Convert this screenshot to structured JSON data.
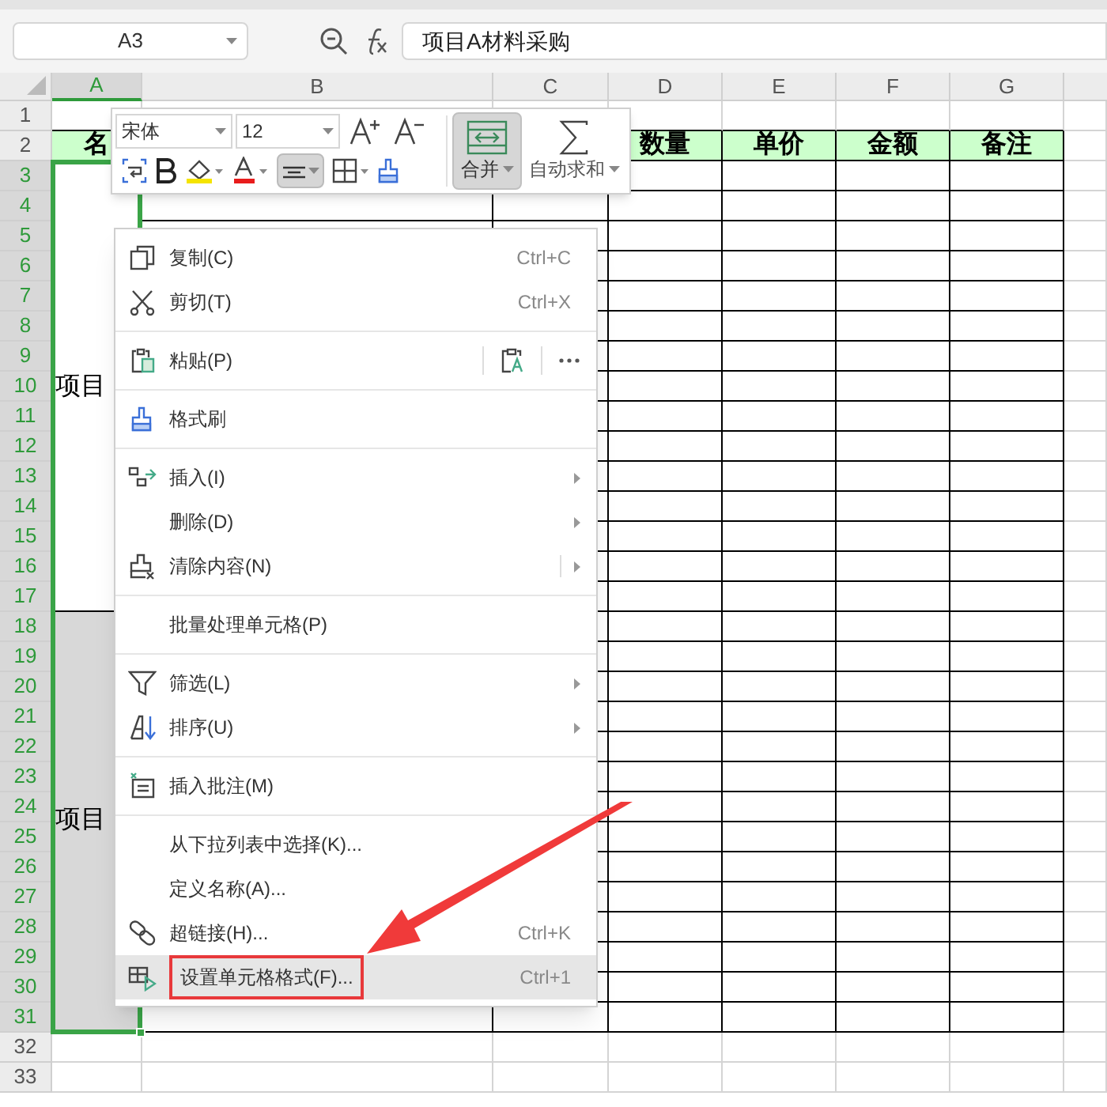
{
  "name_box": {
    "value": "A3"
  },
  "formula_bar": {
    "value": "项目A材料采购"
  },
  "columns": [
    {
      "label": "A",
      "selected": true,
      "header": "名"
    },
    {
      "label": "B",
      "selected": false
    },
    {
      "label": "C",
      "selected": false
    },
    {
      "label": "D",
      "selected": false,
      "header": "数量"
    },
    {
      "label": "E",
      "selected": false,
      "header": "单价"
    },
    {
      "label": "F",
      "selected": false,
      "header": "金额"
    },
    {
      "label": "G",
      "selected": false,
      "header": "备注"
    }
  ],
  "rows": [
    {
      "label": "1",
      "selected": false
    },
    {
      "label": "2",
      "selected": false
    },
    {
      "label": "3",
      "selected": true
    },
    {
      "label": "4",
      "selected": true
    },
    {
      "label": "5",
      "selected": true
    },
    {
      "label": "6",
      "selected": true
    },
    {
      "label": "7",
      "selected": true
    },
    {
      "label": "8",
      "selected": true
    },
    {
      "label": "9",
      "selected": true
    },
    {
      "label": "10",
      "selected": true
    },
    {
      "label": "11",
      "selected": true
    },
    {
      "label": "12",
      "selected": true
    },
    {
      "label": "13",
      "selected": true
    },
    {
      "label": "14",
      "selected": true
    },
    {
      "label": "15",
      "selected": true
    },
    {
      "label": "16",
      "selected": true
    },
    {
      "label": "17",
      "selected": true
    },
    {
      "label": "18",
      "selected": true
    },
    {
      "label": "19",
      "selected": true
    },
    {
      "label": "20",
      "selected": true
    },
    {
      "label": "21",
      "selected": true
    },
    {
      "label": "22",
      "selected": true
    },
    {
      "label": "23",
      "selected": true
    },
    {
      "label": "24",
      "selected": true
    },
    {
      "label": "25",
      "selected": true
    },
    {
      "label": "26",
      "selected": true
    },
    {
      "label": "27",
      "selected": true
    },
    {
      "label": "28",
      "selected": true
    },
    {
      "label": "29",
      "selected": true
    },
    {
      "label": "30",
      "selected": true
    },
    {
      "label": "31",
      "selected": true
    },
    {
      "label": "32",
      "selected": false
    },
    {
      "label": "33",
      "selected": false
    }
  ],
  "merged_cells": [
    {
      "text": "项目",
      "active": true
    },
    {
      "text": "项目",
      "active": false
    }
  ],
  "mini_toolbar": {
    "font": "宋体",
    "size": "12",
    "align_pressed": true,
    "merge": {
      "label": "合并",
      "pressed": true
    },
    "autosum": {
      "label": "自动求和",
      "pressed": false
    }
  },
  "context_menu": {
    "groups": [
      [
        {
          "label": "复制(C)",
          "shortcut": "Ctrl+C",
          "submenu": false,
          "hovered": false,
          "highlighted": false
        },
        {
          "label": "剪切(T)",
          "shortcut": "Ctrl+X",
          "submenu": false,
          "hovered": false,
          "highlighted": false
        }
      ],
      [
        {
          "label": "粘贴(P)",
          "kind": "paste",
          "submenu": false,
          "hovered": false,
          "highlighted": false
        }
      ],
      [
        {
          "label": "格式刷",
          "submenu": false,
          "hovered": false,
          "highlighted": false
        }
      ],
      [
        {
          "label": "插入(I)",
          "submenu": true,
          "hovered": false,
          "highlighted": false
        },
        {
          "label": "删除(D)",
          "submenu": true,
          "hovered": false,
          "highlighted": false
        },
        {
          "label": "清除内容(N)",
          "submenu": true,
          "hovered": false,
          "highlighted": false
        }
      ],
      [
        {
          "label": "批量处理单元格(P)",
          "submenu": false,
          "hovered": false,
          "highlighted": false
        }
      ],
      [
        {
          "label": "筛选(L)",
          "submenu": true,
          "hovered": false,
          "highlighted": false
        },
        {
          "label": "排序(U)",
          "submenu": true,
          "hovered": false,
          "highlighted": false
        }
      ],
      [
        {
          "label": "插入批注(M)",
          "submenu": false,
          "hovered": false,
          "highlighted": false
        }
      ],
      [
        {
          "label": "从下拉列表中选择(K)...",
          "submenu": false,
          "hovered": false,
          "highlighted": false
        },
        {
          "label": "定义名称(A)...",
          "submenu": false,
          "hovered": false,
          "highlighted": false
        },
        {
          "label": "超链接(H)...",
          "shortcut": "Ctrl+K",
          "submenu": false,
          "hovered": false,
          "highlighted": false
        },
        {
          "label": "设置单元格格式(F)...",
          "shortcut": "Ctrl+1",
          "submenu": false,
          "hovered": true,
          "highlighted": true
        }
      ]
    ]
  }
}
